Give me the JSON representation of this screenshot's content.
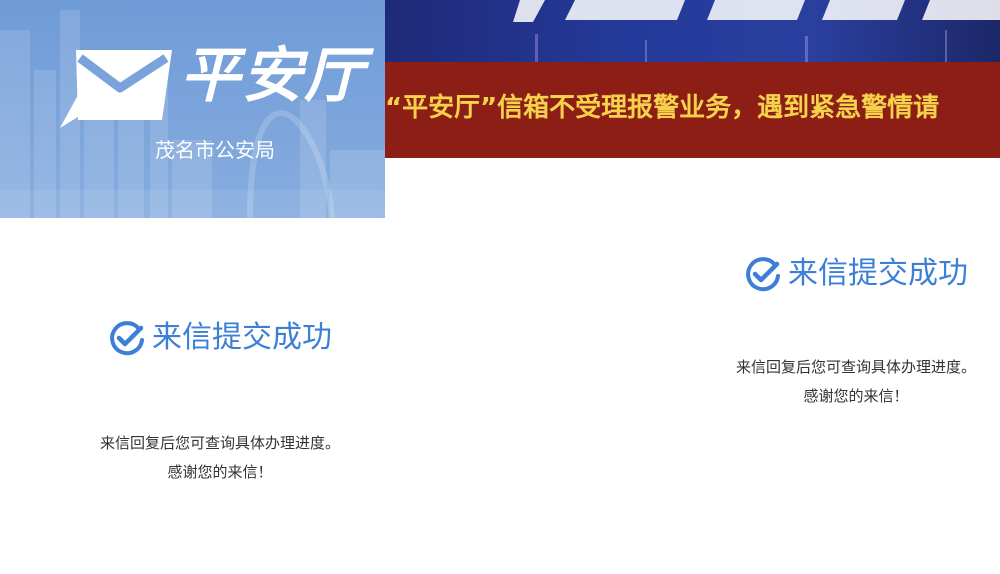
{
  "header": {
    "brand_title": "平安厅",
    "brand_subtitle": "茂名市公安局",
    "logo_icon": "envelope-logo-icon"
  },
  "banner": {
    "notice": "“平安厅”信箱不受理报警业务，遇到紧急警情请"
  },
  "success_panels": [
    {
      "title": "来信提交成功",
      "line1": "来信回复后您可查询具体办理进度。",
      "line2": "感谢您的来信！",
      "icon": "check-circle-icon"
    },
    {
      "title": "来信提交成功",
      "line1": "来信回复后您可查询具体办理进度。",
      "line2": "感谢您的来信！",
      "icon": "check-circle-icon"
    }
  ],
  "colors": {
    "brand_blue": "#7aa3db",
    "ribbon_red": "#8c1e16",
    "ribbon_text": "#f6d24a",
    "success_blue": "#3d7fd6"
  }
}
